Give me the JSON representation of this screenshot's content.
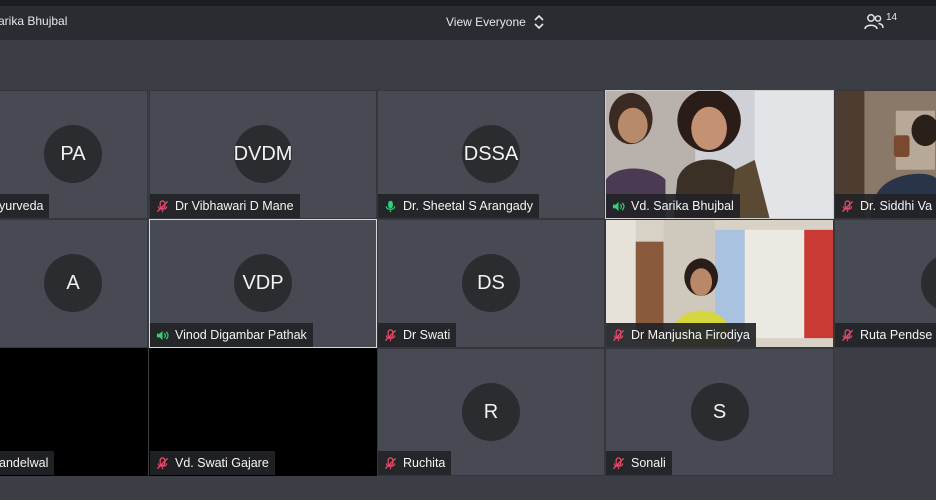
{
  "header": {
    "meeting_title": "arika Bhujbal",
    "view_label": "View Everyone",
    "participant_count": "14"
  },
  "tiles": [
    {
      "initials": "PA",
      "name": "yurveda"
    },
    {
      "initials": "DVDM",
      "name": "Dr Vibhawari D Mane"
    },
    {
      "initials": "DSSA",
      "name": "Dr. Sheetal S Arangady"
    },
    {
      "name": "Vd. Sarika Bhujbal"
    },
    {
      "name": "Dr. Siddhi Va"
    },
    {
      "initials": "A"
    },
    {
      "initials": "VDP",
      "name": "Vinod Digambar Pathak"
    },
    {
      "initials": "DS",
      "name": "Dr Swati"
    },
    {
      "name": "Dr Manjusha Firodiya"
    },
    {
      "initials": "R",
      "name": "Ruta Pendse"
    },
    {
      "name": "andelwal"
    },
    {
      "name": "Vd. Swati Gajare"
    },
    {
      "initials": "R",
      "name": "Ruchita"
    },
    {
      "initials": "S",
      "name": "Sonali"
    }
  ],
  "colors": {
    "muted_mic": "#e04a6a",
    "active_mic": "#2fd07a",
    "tile_bg": "#474a52",
    "avatar_bg": "#2b2c30"
  }
}
